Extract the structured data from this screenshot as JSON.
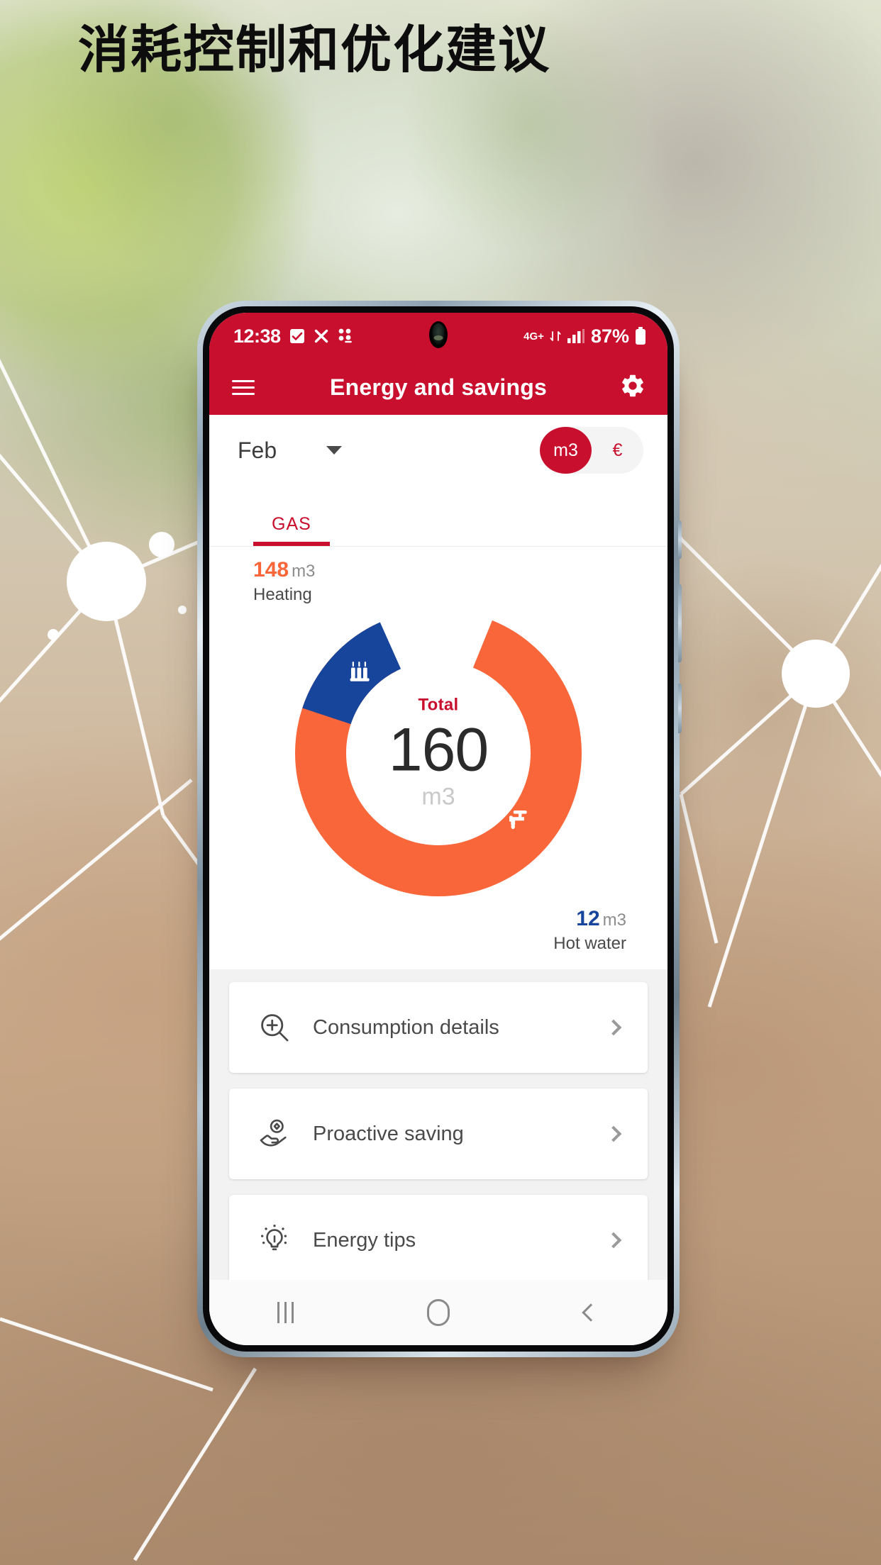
{
  "headline": "消耗控制和优化建议",
  "colors": {
    "brand_red": "#c8102e",
    "heating_orange": "#f9663a",
    "hotwater_blue": "#16459b",
    "text_dark": "#4a4a4a",
    "muted_gray": "#8c8c8c"
  },
  "phone": {
    "status_bar": {
      "time": "12:38",
      "icons": [
        "checkbox-icon",
        "close-x-icon",
        "braille-dots-icon"
      ],
      "network_label": "4G+",
      "battery_text": "87%"
    },
    "app_bar": {
      "menu_icon": "hamburger-menu-icon",
      "title": "Energy and savings",
      "settings_icon": "gear-icon"
    },
    "period": {
      "selected_month": "Feb",
      "dropdown_icon": "chevron-down-icon",
      "unit_toggle": {
        "options": [
          "m3",
          "€"
        ],
        "selected": "m3"
      }
    },
    "tabs": [
      {
        "label": "GAS",
        "active": true
      }
    ],
    "chart_legends": {
      "heating": {
        "value": "148",
        "unit": "m3",
        "name": "Heating"
      },
      "hot_water": {
        "value": "12",
        "unit": "m3",
        "name": "Hot water"
      }
    },
    "donut_center": {
      "label": "Total",
      "value": "160",
      "unit": "m3"
    },
    "menu_items": [
      {
        "icon": "magnifier-plus-icon",
        "label": "Consumption details",
        "chevron": "chevron-right-icon"
      },
      {
        "icon": "hand-coin-icon",
        "label": "Proactive saving",
        "chevron": "chevron-right-icon"
      },
      {
        "icon": "lightbulb-icon",
        "label": "Energy tips",
        "chevron": "chevron-right-icon"
      }
    ],
    "nav_bar": {
      "recents": "recents-icon",
      "home": "home-icon",
      "back": "back-icon"
    }
  },
  "chart_data": {
    "type": "pie",
    "title": "Total",
    "categories": [
      "Heating",
      "Hot water"
    ],
    "values": [
      148,
      12
    ],
    "units": "m3",
    "total": 160,
    "colors": [
      "#f9663a",
      "#16459b"
    ],
    "legend_position": "outside-corners",
    "donut": true,
    "segment_icons": [
      "radiator-icon",
      "faucet-icon"
    ]
  }
}
